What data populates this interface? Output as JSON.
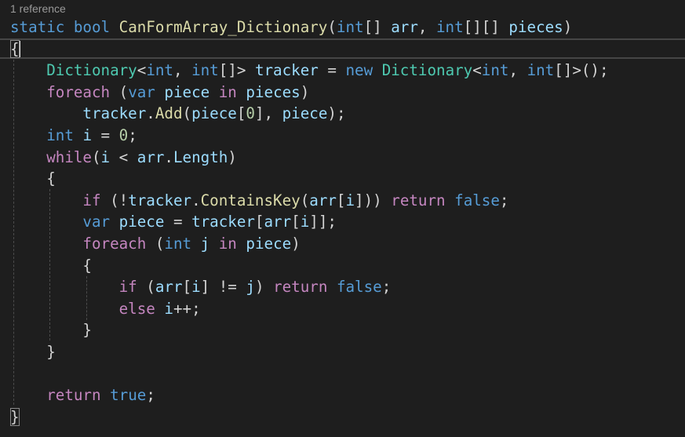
{
  "editor": {
    "codelens": "1 reference",
    "lines": [
      [
        {
          "t": "static",
          "c": "kw"
        },
        {
          "t": " ",
          "c": "pl"
        },
        {
          "t": "bool",
          "c": "kw"
        },
        {
          "t": " ",
          "c": "pl"
        },
        {
          "t": "CanFormArray_Dictionary",
          "c": "fn"
        },
        {
          "t": "(",
          "c": "pl"
        },
        {
          "t": "int",
          "c": "kw"
        },
        {
          "t": "[] ",
          "c": "pl"
        },
        {
          "t": "arr",
          "c": "var"
        },
        {
          "t": ", ",
          "c": "pl"
        },
        {
          "t": "int",
          "c": "kw"
        },
        {
          "t": "[][] ",
          "c": "pl"
        },
        {
          "t": "pieces",
          "c": "var"
        },
        {
          "t": ")",
          "c": "pl"
        }
      ],
      [
        {
          "t": "{",
          "c": "pl"
        }
      ],
      [
        {
          "t": "    ",
          "c": "pl"
        },
        {
          "t": "Dictionary",
          "c": "ty"
        },
        {
          "t": "<",
          "c": "pl"
        },
        {
          "t": "int",
          "c": "kw"
        },
        {
          "t": ", ",
          "c": "pl"
        },
        {
          "t": "int",
          "c": "kw"
        },
        {
          "t": "[]> ",
          "c": "pl"
        },
        {
          "t": "tracker",
          "c": "var"
        },
        {
          "t": " = ",
          "c": "pl"
        },
        {
          "t": "new",
          "c": "kw"
        },
        {
          "t": " ",
          "c": "pl"
        },
        {
          "t": "Dictionary",
          "c": "ty"
        },
        {
          "t": "<",
          "c": "pl"
        },
        {
          "t": "int",
          "c": "kw"
        },
        {
          "t": ", ",
          "c": "pl"
        },
        {
          "t": "int",
          "c": "kw"
        },
        {
          "t": "[]>();",
          "c": "pl"
        }
      ],
      [
        {
          "t": "    ",
          "c": "pl"
        },
        {
          "t": "foreach",
          "c": "ctl"
        },
        {
          "t": " (",
          "c": "pl"
        },
        {
          "t": "var",
          "c": "kw"
        },
        {
          "t": " ",
          "c": "pl"
        },
        {
          "t": "piece",
          "c": "var"
        },
        {
          "t": " ",
          "c": "pl"
        },
        {
          "t": "in",
          "c": "ctl"
        },
        {
          "t": " ",
          "c": "pl"
        },
        {
          "t": "pieces",
          "c": "var"
        },
        {
          "t": ")",
          "c": "pl"
        }
      ],
      [
        {
          "t": "        ",
          "c": "pl"
        },
        {
          "t": "tracker",
          "c": "var"
        },
        {
          "t": ".",
          "c": "pl"
        },
        {
          "t": "Add",
          "c": "fn"
        },
        {
          "t": "(",
          "c": "pl"
        },
        {
          "t": "piece",
          "c": "var"
        },
        {
          "t": "[",
          "c": "pl"
        },
        {
          "t": "0",
          "c": "num"
        },
        {
          "t": "], ",
          "c": "pl"
        },
        {
          "t": "piece",
          "c": "var"
        },
        {
          "t": ");",
          "c": "pl"
        }
      ],
      [
        {
          "t": "    ",
          "c": "pl"
        },
        {
          "t": "int",
          "c": "kw"
        },
        {
          "t": " ",
          "c": "pl"
        },
        {
          "t": "i",
          "c": "var"
        },
        {
          "t": " = ",
          "c": "pl"
        },
        {
          "t": "0",
          "c": "num"
        },
        {
          "t": ";",
          "c": "pl"
        }
      ],
      [
        {
          "t": "    ",
          "c": "pl"
        },
        {
          "t": "while",
          "c": "ctl"
        },
        {
          "t": "(",
          "c": "pl"
        },
        {
          "t": "i",
          "c": "var"
        },
        {
          "t": " < ",
          "c": "pl"
        },
        {
          "t": "arr",
          "c": "var"
        },
        {
          "t": ".",
          "c": "pl"
        },
        {
          "t": "Length",
          "c": "var"
        },
        {
          "t": ")",
          "c": "pl"
        }
      ],
      [
        {
          "t": "    {",
          "c": "pl"
        }
      ],
      [
        {
          "t": "        ",
          "c": "pl"
        },
        {
          "t": "if",
          "c": "ctl"
        },
        {
          "t": " (!",
          "c": "pl"
        },
        {
          "t": "tracker",
          "c": "var"
        },
        {
          "t": ".",
          "c": "pl"
        },
        {
          "t": "ContainsKey",
          "c": "fn"
        },
        {
          "t": "(",
          "c": "pl"
        },
        {
          "t": "arr",
          "c": "var"
        },
        {
          "t": "[",
          "c": "pl"
        },
        {
          "t": "i",
          "c": "var"
        },
        {
          "t": "])) ",
          "c": "pl"
        },
        {
          "t": "return",
          "c": "ctl"
        },
        {
          "t": " ",
          "c": "pl"
        },
        {
          "t": "false",
          "c": "kw"
        },
        {
          "t": ";",
          "c": "pl"
        }
      ],
      [
        {
          "t": "        ",
          "c": "pl"
        },
        {
          "t": "var",
          "c": "kw"
        },
        {
          "t": " ",
          "c": "pl"
        },
        {
          "t": "piece",
          "c": "var"
        },
        {
          "t": " = ",
          "c": "pl"
        },
        {
          "t": "tracker",
          "c": "var"
        },
        {
          "t": "[",
          "c": "pl"
        },
        {
          "t": "arr",
          "c": "var"
        },
        {
          "t": "[",
          "c": "pl"
        },
        {
          "t": "i",
          "c": "var"
        },
        {
          "t": "]];",
          "c": "pl"
        }
      ],
      [
        {
          "t": "        ",
          "c": "pl"
        },
        {
          "t": "foreach",
          "c": "ctl"
        },
        {
          "t": " (",
          "c": "pl"
        },
        {
          "t": "int",
          "c": "kw"
        },
        {
          "t": " ",
          "c": "pl"
        },
        {
          "t": "j",
          "c": "var"
        },
        {
          "t": " ",
          "c": "pl"
        },
        {
          "t": "in",
          "c": "ctl"
        },
        {
          "t": " ",
          "c": "pl"
        },
        {
          "t": "piece",
          "c": "var"
        },
        {
          "t": ")",
          "c": "pl"
        }
      ],
      [
        {
          "t": "        {",
          "c": "pl"
        }
      ],
      [
        {
          "t": "            ",
          "c": "pl"
        },
        {
          "t": "if",
          "c": "ctl"
        },
        {
          "t": " (",
          "c": "pl"
        },
        {
          "t": "arr",
          "c": "var"
        },
        {
          "t": "[",
          "c": "pl"
        },
        {
          "t": "i",
          "c": "var"
        },
        {
          "t": "] != ",
          "c": "pl"
        },
        {
          "t": "j",
          "c": "var"
        },
        {
          "t": ") ",
          "c": "pl"
        },
        {
          "t": "return",
          "c": "ctl"
        },
        {
          "t": " ",
          "c": "pl"
        },
        {
          "t": "false",
          "c": "kw"
        },
        {
          "t": ";",
          "c": "pl"
        }
      ],
      [
        {
          "t": "            ",
          "c": "pl"
        },
        {
          "t": "else",
          "c": "ctl"
        },
        {
          "t": " ",
          "c": "pl"
        },
        {
          "t": "i",
          "c": "var"
        },
        {
          "t": "++;",
          "c": "pl"
        }
      ],
      [
        {
          "t": "        }",
          "c": "pl"
        }
      ],
      [
        {
          "t": "    }",
          "c": "pl"
        }
      ],
      [],
      [
        {
          "t": "    ",
          "c": "pl"
        },
        {
          "t": "return",
          "c": "ctl"
        },
        {
          "t": " ",
          "c": "pl"
        },
        {
          "t": "true",
          "c": "kw"
        },
        {
          "t": ";",
          "c": "pl"
        }
      ],
      [
        {
          "t": "}",
          "c": "pl"
        }
      ]
    ]
  },
  "colors": {
    "background": "#1e1e1e",
    "keyword": "#569cd6",
    "control": "#c586c0",
    "type": "#4ec9b0",
    "function": "#dcdcaa",
    "variable": "#9cdcfe",
    "number": "#b5cea8",
    "text": "#d4d4d4"
  }
}
